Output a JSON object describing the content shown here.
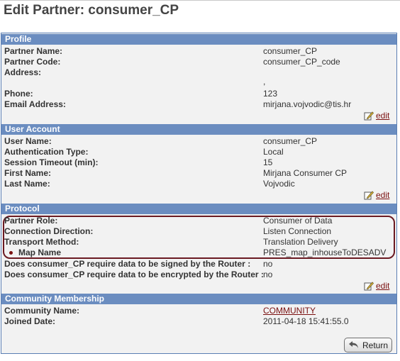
{
  "page": {
    "title": "Edit Partner: consumer_CP"
  },
  "profile": {
    "header": "Profile",
    "rows": [
      {
        "label": "Partner Name:",
        "value": "consumer_CP"
      },
      {
        "label": "Partner Code:",
        "value": "consumer_CP_code"
      },
      {
        "label": "Address:",
        "value": ""
      },
      {
        "label": "",
        "value": ","
      },
      {
        "label": "Phone:",
        "value": "123"
      },
      {
        "label": "Email Address:",
        "value": "mirjana.vojvodic@tis.hr"
      }
    ],
    "edit_label": "edit"
  },
  "user_account": {
    "header": "User Account",
    "rows": [
      {
        "label": "User Name:",
        "value": "consumer_CP"
      },
      {
        "label": "Authentication Type:",
        "value": "Local"
      },
      {
        "label": "Session Timeout (min):",
        "value": "15"
      },
      {
        "label": "First Name:",
        "value": "Mirjana Consumer CP"
      },
      {
        "label": "Last Name:",
        "value": "Vojvodic"
      }
    ],
    "edit_label": "edit"
  },
  "protocol": {
    "header": "Protocol",
    "rows": [
      {
        "label": "Partner Role:",
        "value": "Consumer of Data"
      },
      {
        "label": "Connection Direction:",
        "value": "Listen Connection"
      },
      {
        "label": "Transport Method:",
        "value": "Translation Delivery"
      },
      {
        "label": "Map Name",
        "value": "PRES_map_inhouseToDESADV"
      }
    ],
    "signed_label": "Does  consumer_CP require data to be signed by the Router :",
    "signed_value": "no",
    "encrypted_label": "Does  consumer_CP require data to be encrypted by the Router :",
    "encrypted_value": "no",
    "edit_label": "edit"
  },
  "community": {
    "header": "Community Membership",
    "rows": [
      {
        "label": "Community Name:",
        "value": "COMMUNITY"
      },
      {
        "label": "Joined Date:",
        "value": "2011-04-18 15:41:55.0"
      }
    ]
  },
  "actions": {
    "return_label": "Return"
  },
  "colors": {
    "section_header": "#6b8dc0",
    "link": "#7a1010",
    "highlight_border": "#6b1a22"
  },
  "icons": {
    "edit": "pencil-edit-icon",
    "return": "return-arrow-icon"
  }
}
